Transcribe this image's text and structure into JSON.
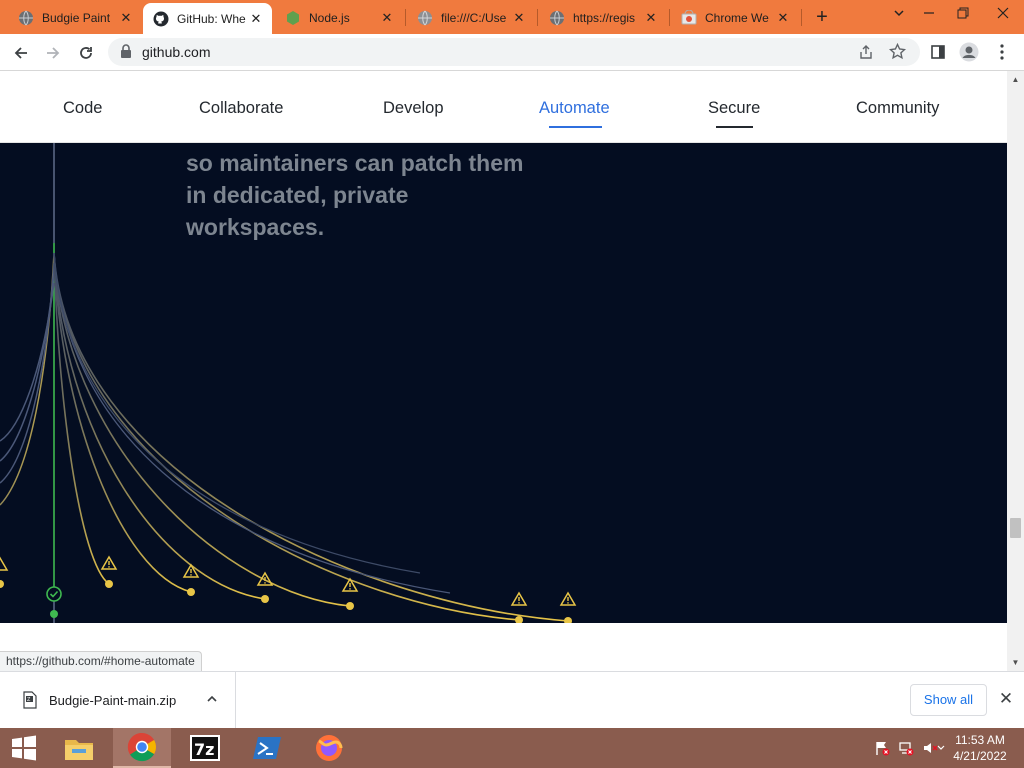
{
  "browser": {
    "tabs": [
      {
        "title": "Budgie Paint",
        "icon": "globe-icon"
      },
      {
        "title": "GitHub: Whe",
        "icon": "github-icon"
      },
      {
        "title": "Node.js",
        "icon": "nodejs-icon"
      },
      {
        "title": "file:///C:/Use",
        "icon": "globe-icon"
      },
      {
        "title": "https://regis",
        "icon": "globe-icon"
      },
      {
        "title": "Chrome We",
        "icon": "chrome-webstore-icon"
      }
    ],
    "active_tab_index": 1,
    "address": "github.com",
    "status_url": "https://github.com/#home-automate"
  },
  "subnav": {
    "items": [
      "Code",
      "Collaborate",
      "Develop",
      "Automate",
      "Secure",
      "Community"
    ],
    "current": "Automate",
    "current_color": "#2f6fde"
  },
  "hero": {
    "text_lines": [
      "so maintainers can patch them",
      "in dedicated, private",
      "workspaces."
    ],
    "background": "#040d21",
    "curve_color": "#e8c547",
    "success_color": "#3fb950"
  },
  "downloads": {
    "file_name": "Budgie-Paint-main.zip",
    "show_all_label": "Show all"
  },
  "taskbar": {
    "apps": [
      "file-explorer-icon",
      "chrome-icon",
      "7zip-icon",
      "powershell-icon",
      "firefox-icon"
    ],
    "active_app": "chrome-icon",
    "time": "11:53 AM",
    "date": "4/21/2022"
  }
}
